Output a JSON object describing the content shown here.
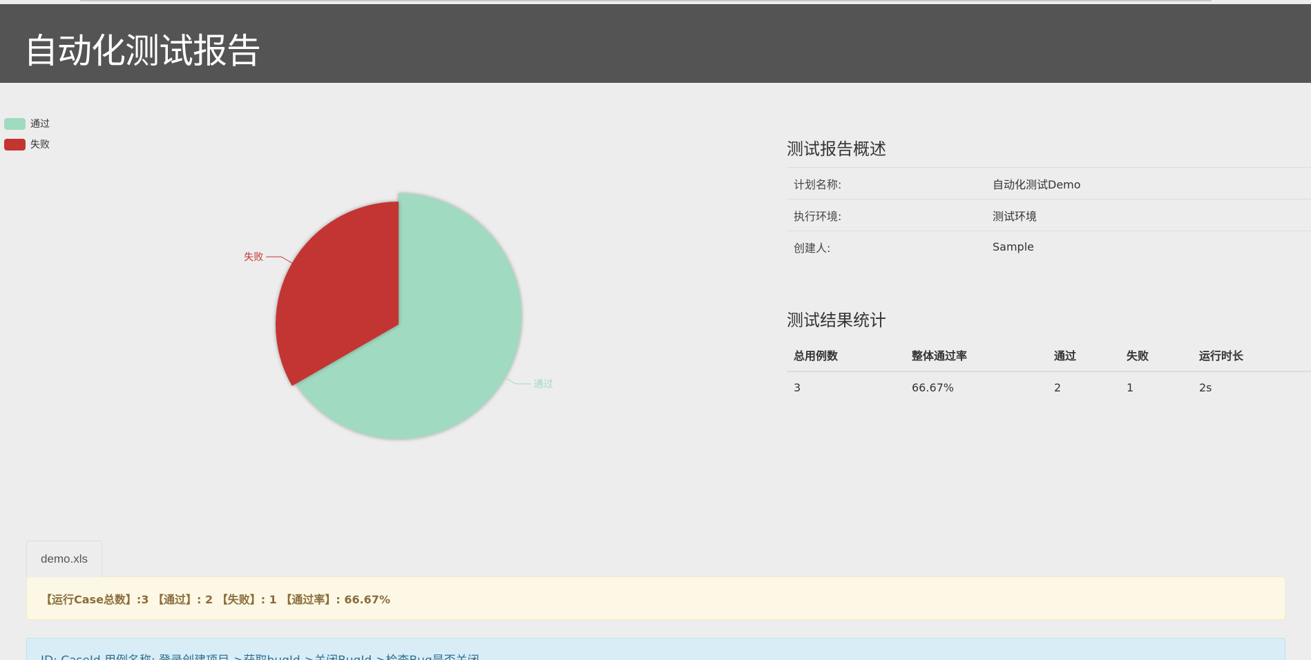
{
  "header": {
    "title": "自动化测试报告"
  },
  "chart_data": {
    "type": "pie",
    "categories": [
      "通过",
      "失败"
    ],
    "values": [
      2,
      1
    ],
    "colors": [
      "#a0dac0",
      "#c33531"
    ],
    "legend_position": "top-left"
  },
  "overview": {
    "title": "测试报告概述",
    "rows": [
      {
        "key": "计划名称:",
        "value": "自动化测试Demo"
      },
      {
        "key": "执行环境:",
        "value": "测试环境"
      },
      {
        "key": "创建人:",
        "value": "Sample"
      }
    ]
  },
  "stats": {
    "title": "测试结果统计",
    "headers": [
      "总用例数",
      "整体通过率",
      "通过",
      "失败",
      "运行时长"
    ],
    "values": [
      "3",
      "66.67%",
      "2",
      "1",
      "2s"
    ]
  },
  "tabs": [
    {
      "label": "demo.xls"
    }
  ],
  "summary": {
    "text": "【运行Case总数】:3 【通过】: 2 【失败】: 1 【通过率】: 66.67%"
  },
  "case": {
    "text": "ID: CaseId   用例名称: 登录创建项目->获取bugId->关闭BugId->检查Bug是否关闭"
  }
}
